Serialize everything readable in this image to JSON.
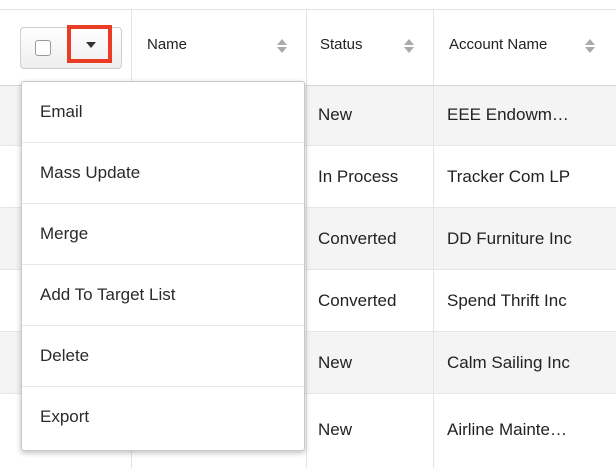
{
  "header": {
    "name_label": "Name",
    "status_label": "Status",
    "account_label": "Account Name"
  },
  "rows": [
    {
      "status": "New",
      "account": "EEE Endowm…"
    },
    {
      "status": "In Process",
      "account": "Tracker Com LP"
    },
    {
      "status": "Converted",
      "account": "DD Furniture Inc"
    },
    {
      "status": "Converted",
      "account": "Spend Thrift Inc"
    },
    {
      "status": "New",
      "account": "Calm Sailing Inc"
    },
    {
      "status": "New",
      "account": "Airline Mainte…"
    }
  ],
  "menu": {
    "items": [
      "Email",
      "Mass Update",
      "Merge",
      "Add To Target List",
      "Delete",
      "Export"
    ]
  },
  "colors": {
    "highlight_border": "#ea3b23",
    "row_alt": "#f4f4f4"
  },
  "icons": {
    "dropdown": "caret-down-icon",
    "sort": "sort-icon"
  }
}
